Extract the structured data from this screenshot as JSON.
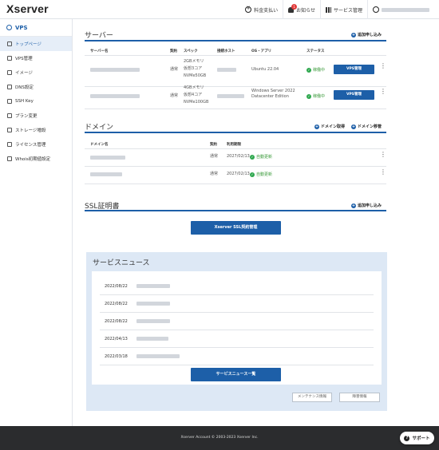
{
  "header": {
    "logo": "Xserver",
    "pay_label": "料金支払い",
    "notice_label": "お知らせ",
    "notice_badge": "1",
    "service_label": "サービス管理"
  },
  "sidebar": {
    "title": "VPS",
    "items": [
      {
        "label": "トップページ",
        "icon": "home-icon"
      },
      {
        "label": "VPS管理",
        "icon": "server-icon"
      },
      {
        "label": "イメージ",
        "icon": "image-icon"
      },
      {
        "label": "DNS設定",
        "icon": "dns-icon"
      },
      {
        "label": "SSH Key",
        "icon": "key-icon"
      },
      {
        "label": "プラン変更",
        "icon": "plan-change-icon"
      },
      {
        "label": "ストレージ増設",
        "icon": "storage-icon"
      },
      {
        "label": "ライセンス管理",
        "icon": "license-icon"
      },
      {
        "label": "Whois初期値設定",
        "icon": "whois-icon"
      }
    ]
  },
  "server": {
    "title": "サーバー",
    "action": "追加申し込み",
    "headers": [
      "サーバー名",
      "契約",
      "スペック",
      "接続ホスト",
      "OS・アプリ",
      "ステータス"
    ],
    "rows": [
      {
        "contract": "通常",
        "spec": [
          "2GBメモリ",
          "仮想3コア",
          "NVMe50GB"
        ],
        "os": "Ubuntu 22.04",
        "status": "稼働中",
        "button": "VPS管理"
      },
      {
        "contract": "通常",
        "spec": [
          "4GBメモリ",
          "仮想4コア",
          "NVMe100GB"
        ],
        "os": "Windows Server 2022 Datacenter Edition",
        "status": "稼働中",
        "button": "VPS管理"
      }
    ]
  },
  "domain": {
    "title": "ドメイン",
    "action_get": "ドメイン取得",
    "action_transfer": "ドメイン移管",
    "headers": [
      "ドメイン名",
      "契約",
      "利用期限"
    ],
    "rows": [
      {
        "contract": "通常",
        "expiry": "2027/02/13",
        "renew": "自動更新"
      },
      {
        "contract": "通常",
        "expiry": "2027/02/13",
        "renew": "自動更新"
      }
    ]
  },
  "ssl": {
    "title": "SSL証明書",
    "action": "追加申し込み",
    "button": "Xserver SSL契約管理"
  },
  "news": {
    "title": "サービスニュース",
    "dates": [
      "2022/08/22",
      "2022/08/22",
      "2022/08/22",
      "2022/04/13",
      "2022/03/18"
    ],
    "button": "サービスニュース一覧",
    "maintenance": "メンテナンス情報",
    "failure": "障害情報"
  },
  "footer": {
    "copyright": "Xserver Account © 2003-2023 Xserver Inc."
  },
  "support": {
    "label": "サポート"
  },
  "colors": {
    "accent": "#1d5fa8",
    "ok": "#2fa84f"
  }
}
